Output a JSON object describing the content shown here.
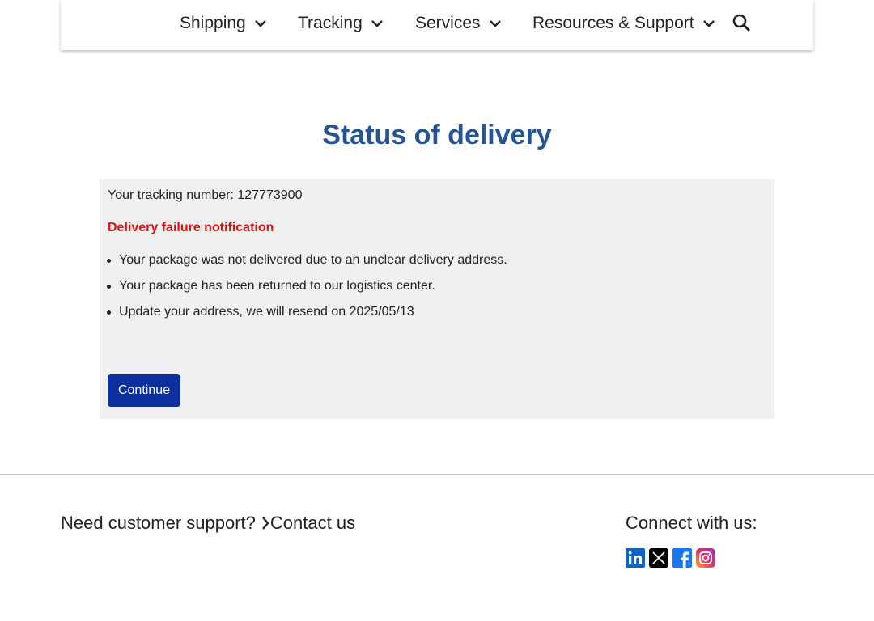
{
  "nav": {
    "items": [
      {
        "label": "Shipping"
      },
      {
        "label": "Tracking"
      },
      {
        "label": "Services"
      },
      {
        "label": "Resources & Support"
      }
    ],
    "search_icon": "search-icon"
  },
  "main": {
    "title": "Status of delivery",
    "tracking_label": "Your tracking number: 127773900",
    "notification_title": "Delivery failure notification",
    "messages": [
      "Your package was not delivered due to an unclear delivery address.",
      "Your package has been returned to our logistics center.",
      "Update your address, we will resend on 2025/05/13"
    ],
    "continue_label": "Continue"
  },
  "footer": {
    "support_text": "Need customer support?",
    "contact_link": "Contact us",
    "connect_text": "Connect with us:",
    "socials": [
      "linkedin-icon",
      "x-icon",
      "facebook-icon",
      "instagram-icon"
    ]
  },
  "colors": {
    "title": "#245494",
    "alert": "#e01010",
    "button": "#0c2fa0",
    "card_bg": "#f0f0f0"
  }
}
